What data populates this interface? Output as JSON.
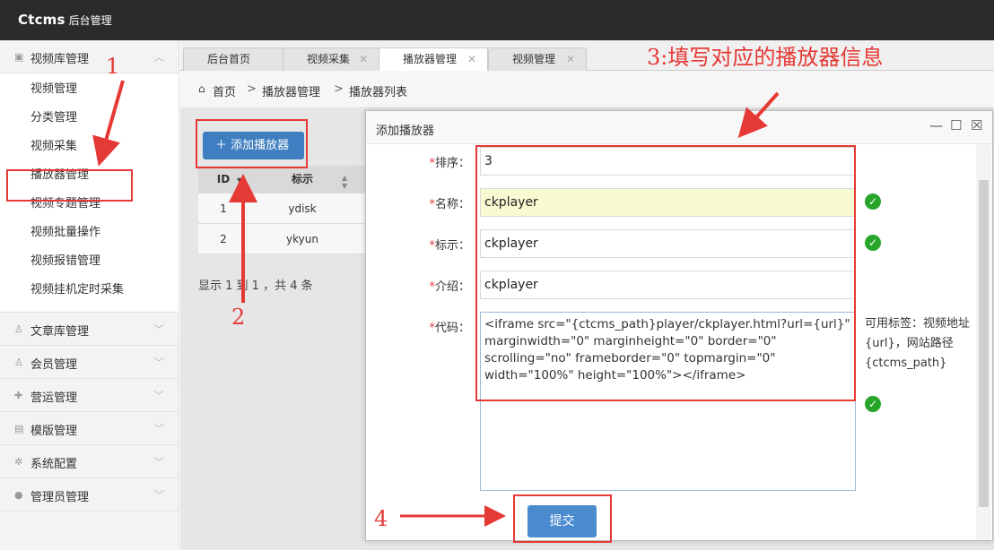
{
  "brand": {
    "main": "Ctcms",
    "sub": "后台管理"
  },
  "sidebar": {
    "groups": [
      {
        "label": "视频库管理",
        "icon": "camera-icon",
        "items": [
          "视频管理",
          "分类管理",
          "视频采集",
          "播放器管理",
          "视频专题管理",
          "视频批量操作",
          "视频报错管理",
          "视频挂机定时采集"
        ]
      },
      {
        "label": "文章库管理",
        "icon": "user-icon"
      },
      {
        "label": "会员管理",
        "icon": "user-icon"
      },
      {
        "label": "营运管理",
        "icon": "puzzle-icon"
      },
      {
        "label": "模版管理",
        "icon": "file-icon"
      },
      {
        "label": "系统配置",
        "icon": "gear-icon"
      },
      {
        "label": "管理员管理",
        "icon": "person-icon"
      }
    ]
  },
  "tabs": [
    {
      "label": "后台首页"
    },
    {
      "label": "视频采集"
    },
    {
      "label": "播放器管理"
    },
    {
      "label": "视频管理"
    }
  ],
  "breadcrumb": {
    "home": "首页",
    "level1": "播放器管理",
    "level2": "播放器列表",
    "sep": ">"
  },
  "list": {
    "add_label": "添加播放器",
    "columns": [
      "ID",
      "标示"
    ],
    "rows": [
      {
        "id": "1",
        "flag": "ydisk"
      },
      {
        "id": "2",
        "flag": "ykyun"
      }
    ],
    "summary": "显示 1 到 1 ，共 4 条"
  },
  "dialog": {
    "title": "添加播放器",
    "fields": {
      "order_label": "排序：",
      "order_value": "3",
      "name_label": "名称：",
      "name_value": "ckplayer",
      "flag_label": "标示：",
      "flag_value": "ckplayer",
      "intro_label": "介绍：",
      "intro_value": "ckplayer",
      "code_label": "代码：",
      "code_value": "<iframe src=\"{ctcms_path}player/ckplayer.html?url={url}\" marginwidth=\"0\" marginheight=\"0\" border=\"0\" scrolling=\"no\" frameborder=\"0\" topmargin=\"0\" width=\"100%\" height=\"100%\"></iframe>"
    },
    "required_mark": "*",
    "hint": "可用标签：视频地址 {url}，网站路径{ctcms_path}",
    "submit_label": "提交"
  },
  "annotations": {
    "n1": "1",
    "n2": "2",
    "n3": "3:填写对应的播放器信息",
    "n4": "4"
  },
  "colors": {
    "annotation": "#e53935",
    "primary": "#3f7fc1",
    "success": "#27a52b",
    "topbar": "#2b2b2b"
  }
}
